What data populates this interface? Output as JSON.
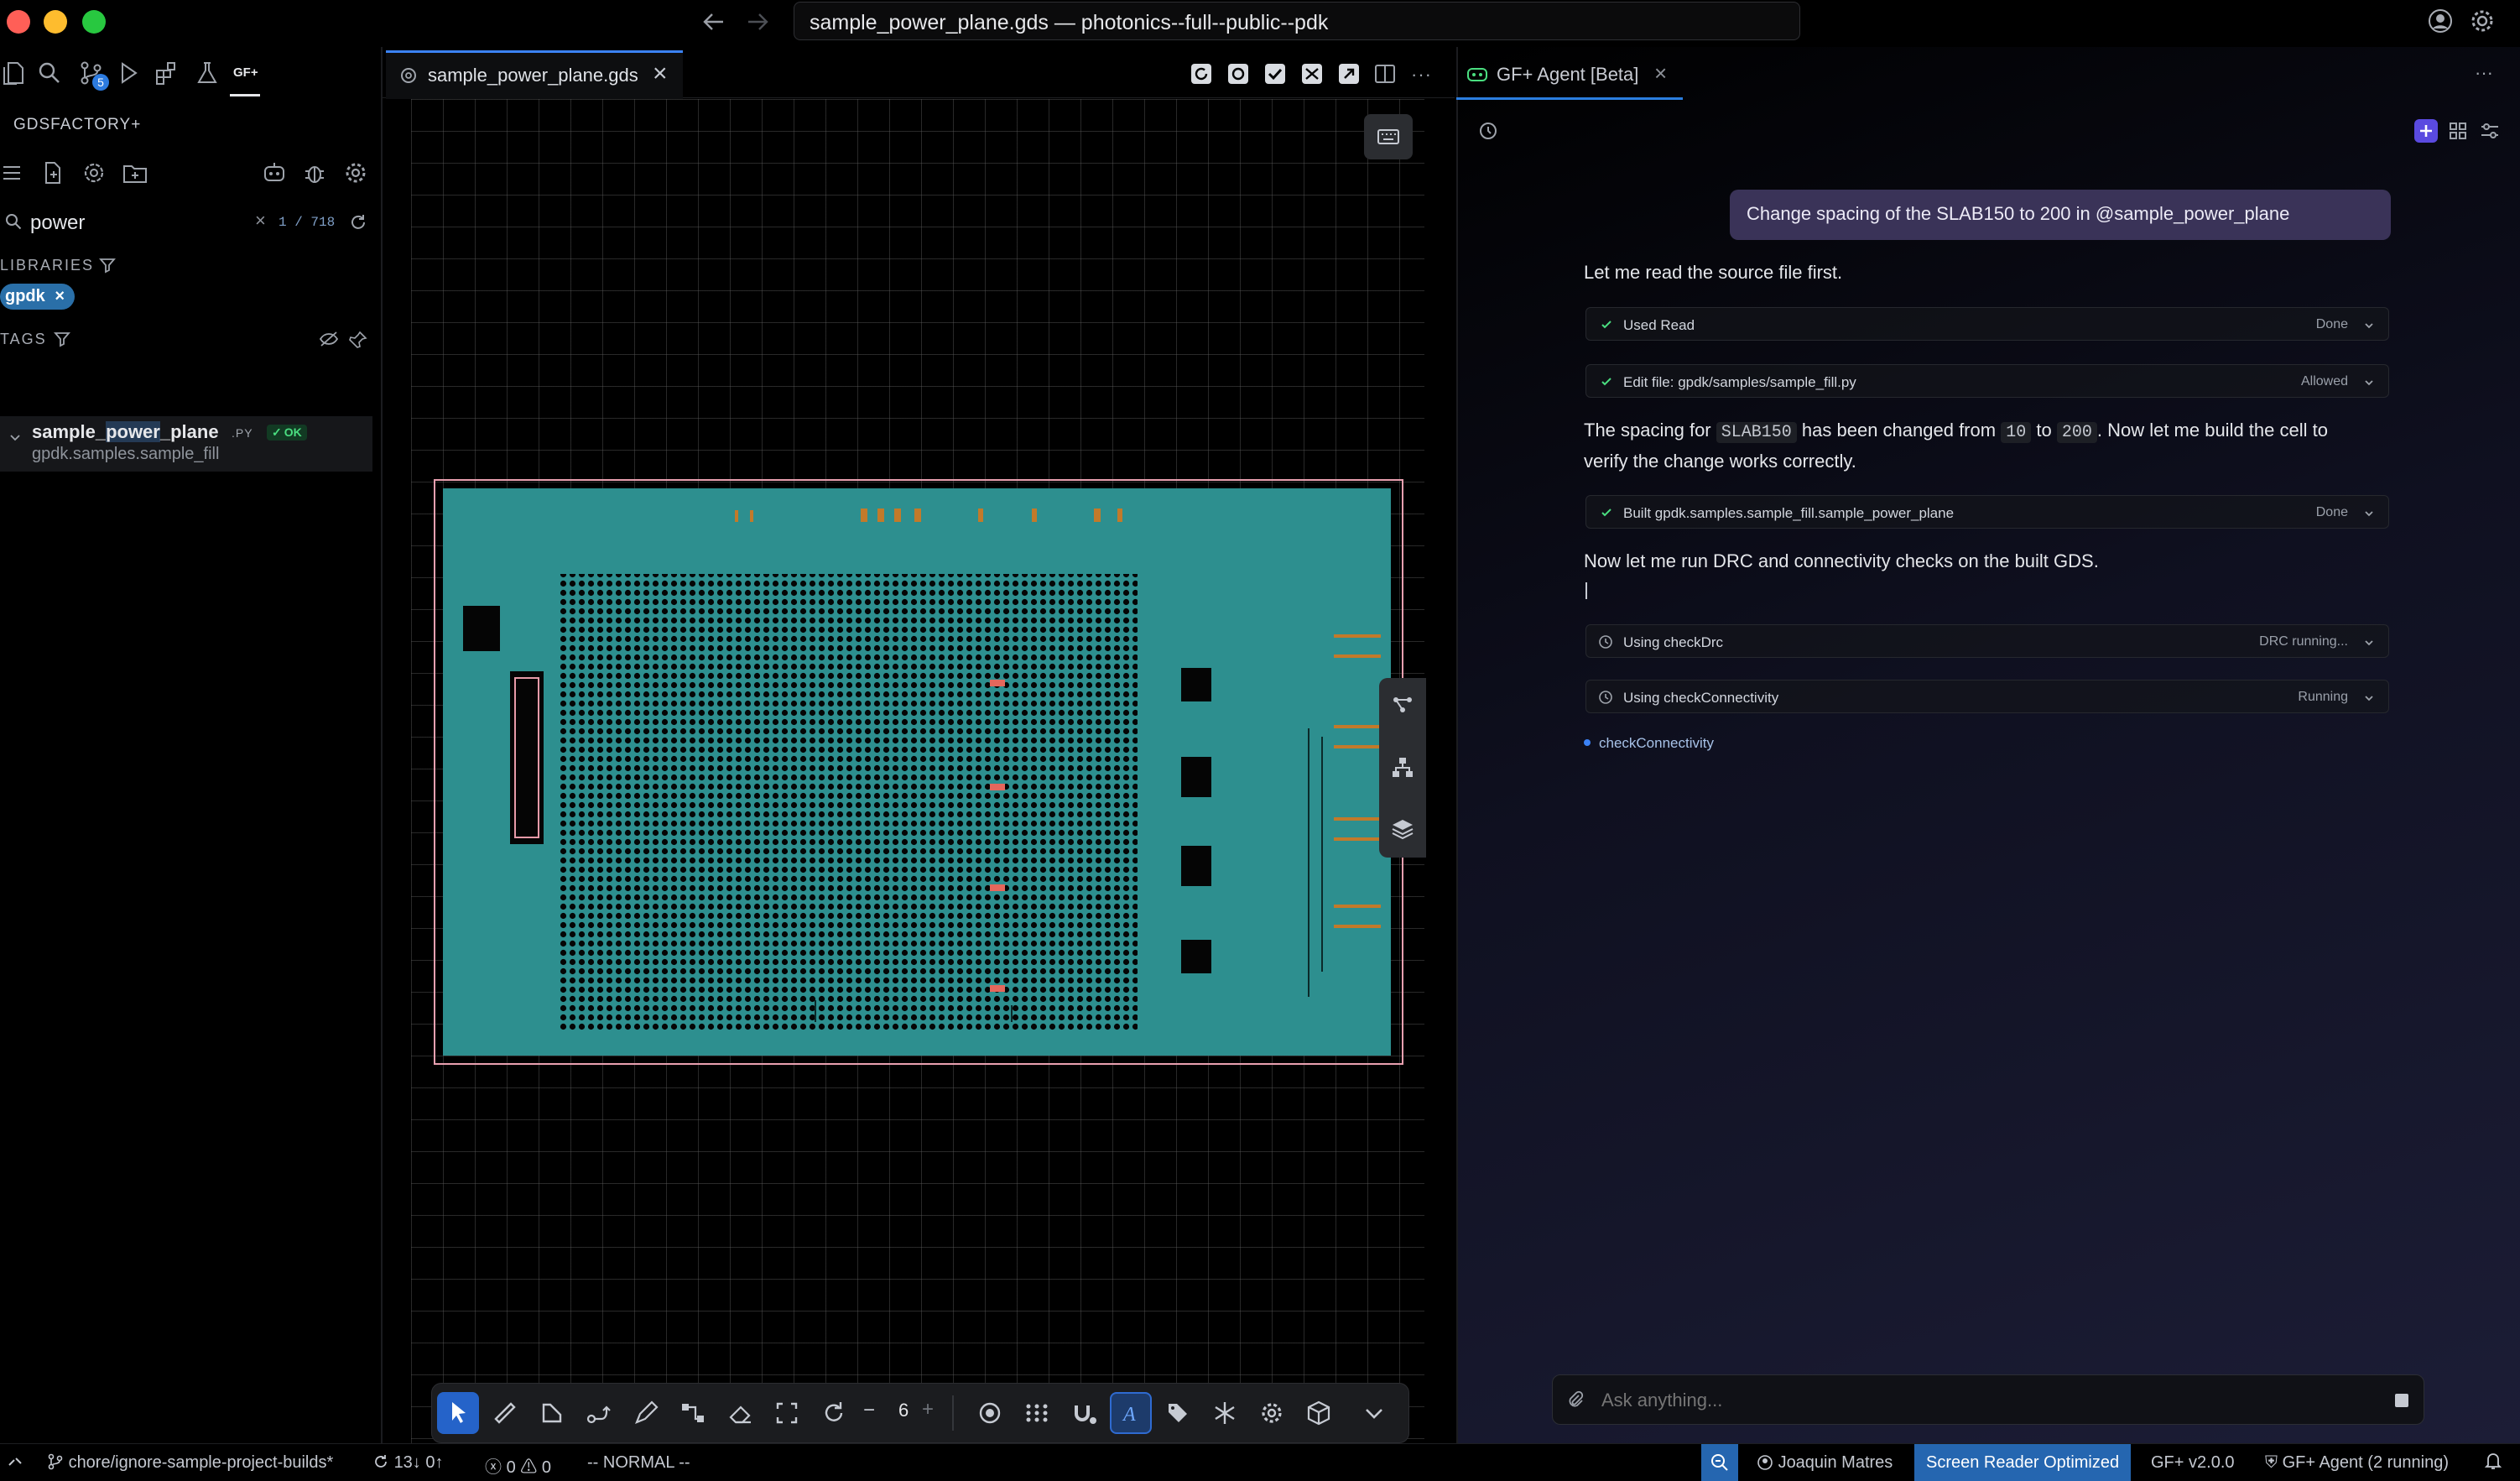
{
  "window": {
    "title": "sample_power_plane.gds — photonics--full--public--pdk",
    "traffic_colors": [
      "#ff5f57",
      "#febc2e",
      "#28c840"
    ]
  },
  "activity_bar": {
    "scm_badge": "5",
    "gf_label": "GF+"
  },
  "sidebar": {
    "header": "GDSFACTORY+",
    "search": {
      "value": "power",
      "count": "1 / 718"
    },
    "libraries_label": "LIBRARIES",
    "library_pill": "gpdk",
    "tags_label": "TAGS",
    "tree_item": {
      "name_prefix": "sample_",
      "name_highlight": "power",
      "name_suffix": "_plane",
      "ext": ".PY",
      "status": "OK",
      "module": "gpdk.samples.sample_fill"
    }
  },
  "editor": {
    "tab_label": "sample_power_plane.gds",
    "zoom_value": "6"
  },
  "agent": {
    "tab_label": "GF+ Agent [Beta]",
    "user_message": "Change spacing of the SLAB150 to 200 in @sample_power_plane",
    "msg1": "Let me read the source file first.",
    "tool1": {
      "label": "Used Read",
      "status": "Done"
    },
    "tool2": {
      "label": "Edit file: gpdk/samples/sample_fill.py",
      "status": "Allowed"
    },
    "msg2": {
      "a": "The spacing for",
      "code1": "SLAB150",
      "b": "has been changed from",
      "code2": "10",
      "c": "to",
      "code3": "200",
      "d": ". Now let me build the cell to",
      "line2": "verify the change works correctly."
    },
    "tool3": {
      "label": "Built gpdk.samples.sample_fill.sample_power_plane",
      "status": "Done"
    },
    "msg3": "Now let me run DRC and connectivity checks on the built GDS.",
    "tool4": {
      "label": "Using checkDrc",
      "status": "DRC running..."
    },
    "tool5": {
      "label": "Using checkConnectivity",
      "status": "Running"
    },
    "progress_item": "checkConnectivity",
    "ask_placeholder": "Ask anything..."
  },
  "statusbar": {
    "branch": "chore/ignore-sample-project-builds*",
    "sync": "13↓ 0↑",
    "errors": "0",
    "warnings": "0",
    "mode": "-- NORMAL --",
    "user": "Joaquin Matres",
    "screen_reader": "Screen Reader Optimized",
    "version": "GF+ v2.0.0",
    "agent_status": "GF+ Agent (2 running)"
  }
}
